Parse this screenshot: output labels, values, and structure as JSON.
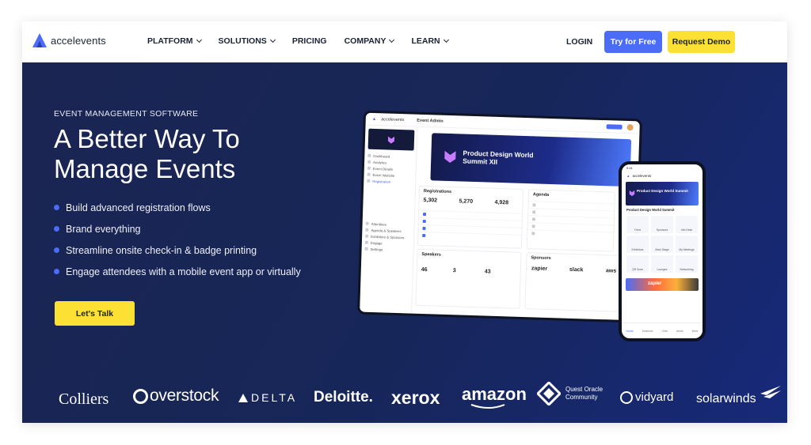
{
  "brand": {
    "name": "accelevents"
  },
  "nav": {
    "items": [
      {
        "label": "PLATFORM",
        "has_menu": true
      },
      {
        "label": "SOLUTIONS",
        "has_menu": true
      },
      {
        "label": "PRICING",
        "has_menu": false
      },
      {
        "label": "COMPANY",
        "has_menu": true
      },
      {
        "label": "LEARN",
        "has_menu": true
      }
    ],
    "login": "LOGIN",
    "try_free": "Try for Free",
    "request_demo": "Request Demo"
  },
  "hero": {
    "eyebrow": "EVENT MANAGEMENT SOFTWARE",
    "headline": "A Better Way To Manage Events",
    "bullets": [
      "Build advanced registration flows",
      "Brand everything",
      "Streamline onsite check-in & badge printing",
      "Engage attendees with a mobile event app or virtually"
    ],
    "cta": "Let's Talk"
  },
  "dashboard": {
    "app": "accelevents",
    "section": "Event Admin",
    "sidebar": [
      "Dashboard",
      "Analytics",
      "Event Details",
      "Event Website",
      "Registration",
      "Attendees",
      "Agenda & Speakers",
      "Exhibitors & Sponsors",
      "Engage",
      "Settings"
    ],
    "banner": "Product Design World Summit XII",
    "registrations": {
      "title": "Registrations",
      "values": [
        "5,302",
        "5,270",
        "4,928"
      ]
    },
    "agenda": {
      "title": "Agenda"
    },
    "speakers": {
      "title": "Speakers",
      "values": [
        "46",
        "3",
        "43"
      ]
    },
    "sponsors": {
      "title": "Sponsors",
      "names": [
        "zapier",
        "slack",
        "aws"
      ]
    }
  },
  "phone": {
    "app": "accelevents",
    "banner": "Product Design World Summit",
    "event": "Product Design World Summit",
    "strip": "zapier",
    "tiles": [
      "Feed",
      "Sponsors",
      "Info Desk",
      "Exhibitors",
      "Main Stage",
      "My Meetings",
      "QR Scan",
      "Lounges",
      "Networking"
    ],
    "tabs": [
      "Home",
      "Sessions",
      "Chat",
      "Alerts",
      "More"
    ]
  },
  "logos": [
    "Colliers",
    "overstock",
    "DELTA",
    "Deloitte.",
    "xerox",
    "amazon",
    "Quest Oracle Community",
    "vidyard",
    "solarwinds"
  ],
  "colors": {
    "navy": "#1a2552",
    "accent_blue": "#4a6cf7",
    "yellow": "#fce134"
  }
}
